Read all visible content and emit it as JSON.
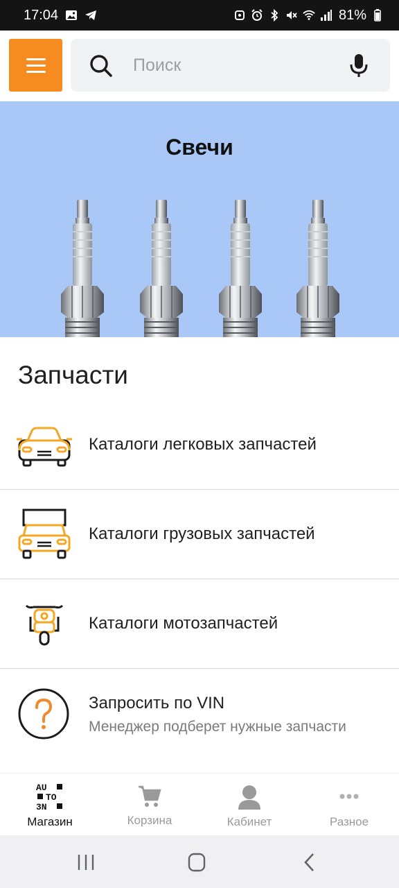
{
  "status_bar": {
    "time": "17:04",
    "battery": "81%",
    "left_icons": [
      "gallery-icon",
      "telegram-icon"
    ],
    "right_icons": [
      "nfc-icon",
      "alarm-icon",
      "bluetooth-icon",
      "mute-icon",
      "wifi-icon",
      "signal-icon",
      "battery-icon"
    ]
  },
  "header": {
    "menu_icon": "hamburger-icon",
    "search": {
      "placeholder": "Поиск",
      "value": ""
    }
  },
  "banner": {
    "title": "Свечи",
    "image": "spark-plugs"
  },
  "section": {
    "title": "Запчасти",
    "items": [
      {
        "label": "Каталоги легковых запчастей",
        "icon": "car-icon"
      },
      {
        "label": "Каталоги грузовых запчастей",
        "icon": "truck-icon"
      },
      {
        "label": "Каталоги мотозапчастей",
        "icon": "motorcycle-icon"
      },
      {
        "label": "Запросить по VIN",
        "subtitle": "Менеджер подберет нужные запчасти",
        "icon": "question-icon"
      }
    ]
  },
  "bottom_nav": {
    "items": [
      {
        "label": "Магазин",
        "icon": "autozn-logo-icon",
        "active": true
      },
      {
        "label": "Корзина",
        "icon": "cart-icon",
        "active": false
      },
      {
        "label": "Кабинет",
        "icon": "user-icon",
        "active": false
      },
      {
        "label": "Разное",
        "icon": "more-icon",
        "active": false
      }
    ]
  },
  "logo_text": [
    "AU",
    "TO",
    "3N"
  ],
  "colors": {
    "accent": "#f68b1f",
    "banner_bg": "#a9c7f7",
    "icon_orange": "#f5a623"
  }
}
